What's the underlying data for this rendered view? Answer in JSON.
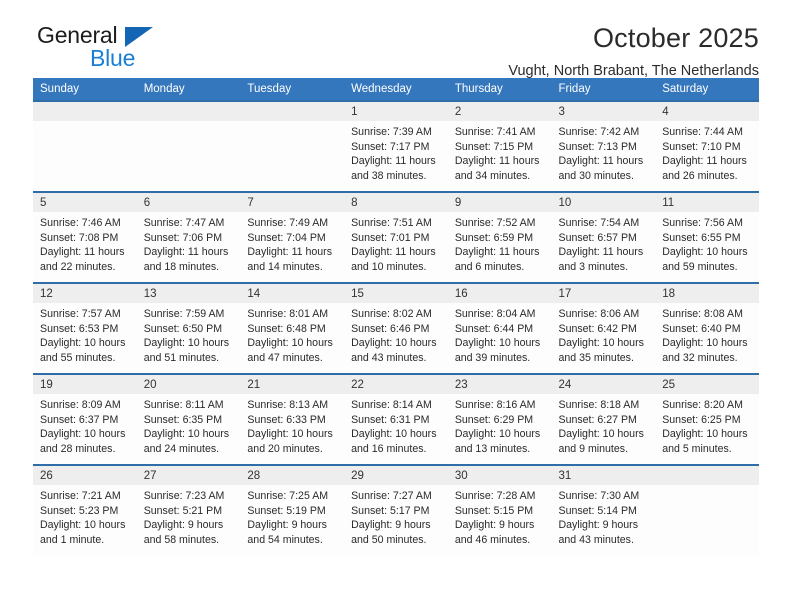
{
  "brand": {
    "name_part1": "General",
    "name_part2": "Blue",
    "accent_color": "#1a7fd4",
    "triangle_color": "#1565b5"
  },
  "header": {
    "title": "October 2025",
    "subtitle": "Vught, North Brabant, The Netherlands",
    "header_bg_color": "#3577bd",
    "row_border_color": "#2e6da8",
    "daynum_band_color": "#eeeeee"
  },
  "weekday_headers": [
    "Sunday",
    "Monday",
    "Tuesday",
    "Wednesday",
    "Thursday",
    "Friday",
    "Saturday"
  ],
  "weeks": [
    [
      {
        "day": "",
        "empty": true,
        "sunrise": "",
        "sunset": "",
        "daylight_line1": "",
        "daylight_line2": ""
      },
      {
        "day": "",
        "empty": true,
        "sunrise": "",
        "sunset": "",
        "daylight_line1": "",
        "daylight_line2": ""
      },
      {
        "day": "",
        "empty": true,
        "sunrise": "",
        "sunset": "",
        "daylight_line1": "",
        "daylight_line2": ""
      },
      {
        "day": "1",
        "empty": false,
        "sunrise": "Sunrise: 7:39 AM",
        "sunset": "Sunset: 7:17 PM",
        "daylight_line1": "Daylight: 11 hours",
        "daylight_line2": "and 38 minutes."
      },
      {
        "day": "2",
        "empty": false,
        "sunrise": "Sunrise: 7:41 AM",
        "sunset": "Sunset: 7:15 PM",
        "daylight_line1": "Daylight: 11 hours",
        "daylight_line2": "and 34 minutes."
      },
      {
        "day": "3",
        "empty": false,
        "sunrise": "Sunrise: 7:42 AM",
        "sunset": "Sunset: 7:13 PM",
        "daylight_line1": "Daylight: 11 hours",
        "daylight_line2": "and 30 minutes."
      },
      {
        "day": "4",
        "empty": false,
        "sunrise": "Sunrise: 7:44 AM",
        "sunset": "Sunset: 7:10 PM",
        "daylight_line1": "Daylight: 11 hours",
        "daylight_line2": "and 26 minutes."
      }
    ],
    [
      {
        "day": "5",
        "empty": false,
        "sunrise": "Sunrise: 7:46 AM",
        "sunset": "Sunset: 7:08 PM",
        "daylight_line1": "Daylight: 11 hours",
        "daylight_line2": "and 22 minutes."
      },
      {
        "day": "6",
        "empty": false,
        "sunrise": "Sunrise: 7:47 AM",
        "sunset": "Sunset: 7:06 PM",
        "daylight_line1": "Daylight: 11 hours",
        "daylight_line2": "and 18 minutes."
      },
      {
        "day": "7",
        "empty": false,
        "sunrise": "Sunrise: 7:49 AM",
        "sunset": "Sunset: 7:04 PM",
        "daylight_line1": "Daylight: 11 hours",
        "daylight_line2": "and 14 minutes."
      },
      {
        "day": "8",
        "empty": false,
        "sunrise": "Sunrise: 7:51 AM",
        "sunset": "Sunset: 7:01 PM",
        "daylight_line1": "Daylight: 11 hours",
        "daylight_line2": "and 10 minutes."
      },
      {
        "day": "9",
        "empty": false,
        "sunrise": "Sunrise: 7:52 AM",
        "sunset": "Sunset: 6:59 PM",
        "daylight_line1": "Daylight: 11 hours",
        "daylight_line2": "and 6 minutes."
      },
      {
        "day": "10",
        "empty": false,
        "sunrise": "Sunrise: 7:54 AM",
        "sunset": "Sunset: 6:57 PM",
        "daylight_line1": "Daylight: 11 hours",
        "daylight_line2": "and 3 minutes."
      },
      {
        "day": "11",
        "empty": false,
        "sunrise": "Sunrise: 7:56 AM",
        "sunset": "Sunset: 6:55 PM",
        "daylight_line1": "Daylight: 10 hours",
        "daylight_line2": "and 59 minutes."
      }
    ],
    [
      {
        "day": "12",
        "empty": false,
        "sunrise": "Sunrise: 7:57 AM",
        "sunset": "Sunset: 6:53 PM",
        "daylight_line1": "Daylight: 10 hours",
        "daylight_line2": "and 55 minutes."
      },
      {
        "day": "13",
        "empty": false,
        "sunrise": "Sunrise: 7:59 AM",
        "sunset": "Sunset: 6:50 PM",
        "daylight_line1": "Daylight: 10 hours",
        "daylight_line2": "and 51 minutes."
      },
      {
        "day": "14",
        "empty": false,
        "sunrise": "Sunrise: 8:01 AM",
        "sunset": "Sunset: 6:48 PM",
        "daylight_line1": "Daylight: 10 hours",
        "daylight_line2": "and 47 minutes."
      },
      {
        "day": "15",
        "empty": false,
        "sunrise": "Sunrise: 8:02 AM",
        "sunset": "Sunset: 6:46 PM",
        "daylight_line1": "Daylight: 10 hours",
        "daylight_line2": "and 43 minutes."
      },
      {
        "day": "16",
        "empty": false,
        "sunrise": "Sunrise: 8:04 AM",
        "sunset": "Sunset: 6:44 PM",
        "daylight_line1": "Daylight: 10 hours",
        "daylight_line2": "and 39 minutes."
      },
      {
        "day": "17",
        "empty": false,
        "sunrise": "Sunrise: 8:06 AM",
        "sunset": "Sunset: 6:42 PM",
        "daylight_line1": "Daylight: 10 hours",
        "daylight_line2": "and 35 minutes."
      },
      {
        "day": "18",
        "empty": false,
        "sunrise": "Sunrise: 8:08 AM",
        "sunset": "Sunset: 6:40 PM",
        "daylight_line1": "Daylight: 10 hours",
        "daylight_line2": "and 32 minutes."
      }
    ],
    [
      {
        "day": "19",
        "empty": false,
        "sunrise": "Sunrise: 8:09 AM",
        "sunset": "Sunset: 6:37 PM",
        "daylight_line1": "Daylight: 10 hours",
        "daylight_line2": "and 28 minutes."
      },
      {
        "day": "20",
        "empty": false,
        "sunrise": "Sunrise: 8:11 AM",
        "sunset": "Sunset: 6:35 PM",
        "daylight_line1": "Daylight: 10 hours",
        "daylight_line2": "and 24 minutes."
      },
      {
        "day": "21",
        "empty": false,
        "sunrise": "Sunrise: 8:13 AM",
        "sunset": "Sunset: 6:33 PM",
        "daylight_line1": "Daylight: 10 hours",
        "daylight_line2": "and 20 minutes."
      },
      {
        "day": "22",
        "empty": false,
        "sunrise": "Sunrise: 8:14 AM",
        "sunset": "Sunset: 6:31 PM",
        "daylight_line1": "Daylight: 10 hours",
        "daylight_line2": "and 16 minutes."
      },
      {
        "day": "23",
        "empty": false,
        "sunrise": "Sunrise: 8:16 AM",
        "sunset": "Sunset: 6:29 PM",
        "daylight_line1": "Daylight: 10 hours",
        "daylight_line2": "and 13 minutes."
      },
      {
        "day": "24",
        "empty": false,
        "sunrise": "Sunrise: 8:18 AM",
        "sunset": "Sunset: 6:27 PM",
        "daylight_line1": "Daylight: 10 hours",
        "daylight_line2": "and 9 minutes."
      },
      {
        "day": "25",
        "empty": false,
        "sunrise": "Sunrise: 8:20 AM",
        "sunset": "Sunset: 6:25 PM",
        "daylight_line1": "Daylight: 10 hours",
        "daylight_line2": "and 5 minutes."
      }
    ],
    [
      {
        "day": "26",
        "empty": false,
        "sunrise": "Sunrise: 7:21 AM",
        "sunset": "Sunset: 5:23 PM",
        "daylight_line1": "Daylight: 10 hours",
        "daylight_line2": "and 1 minute."
      },
      {
        "day": "27",
        "empty": false,
        "sunrise": "Sunrise: 7:23 AM",
        "sunset": "Sunset: 5:21 PM",
        "daylight_line1": "Daylight: 9 hours",
        "daylight_line2": "and 58 minutes."
      },
      {
        "day": "28",
        "empty": false,
        "sunrise": "Sunrise: 7:25 AM",
        "sunset": "Sunset: 5:19 PM",
        "daylight_line1": "Daylight: 9 hours",
        "daylight_line2": "and 54 minutes."
      },
      {
        "day": "29",
        "empty": false,
        "sunrise": "Sunrise: 7:27 AM",
        "sunset": "Sunset: 5:17 PM",
        "daylight_line1": "Daylight: 9 hours",
        "daylight_line2": "and 50 minutes."
      },
      {
        "day": "30",
        "empty": false,
        "sunrise": "Sunrise: 7:28 AM",
        "sunset": "Sunset: 5:15 PM",
        "daylight_line1": "Daylight: 9 hours",
        "daylight_line2": "and 46 minutes."
      },
      {
        "day": "31",
        "empty": false,
        "sunrise": "Sunrise: 7:30 AM",
        "sunset": "Sunset: 5:14 PM",
        "daylight_line1": "Daylight: 9 hours",
        "daylight_line2": "and 43 minutes."
      },
      {
        "day": "",
        "empty": true,
        "sunrise": "",
        "sunset": "",
        "daylight_line1": "",
        "daylight_line2": ""
      }
    ]
  ]
}
